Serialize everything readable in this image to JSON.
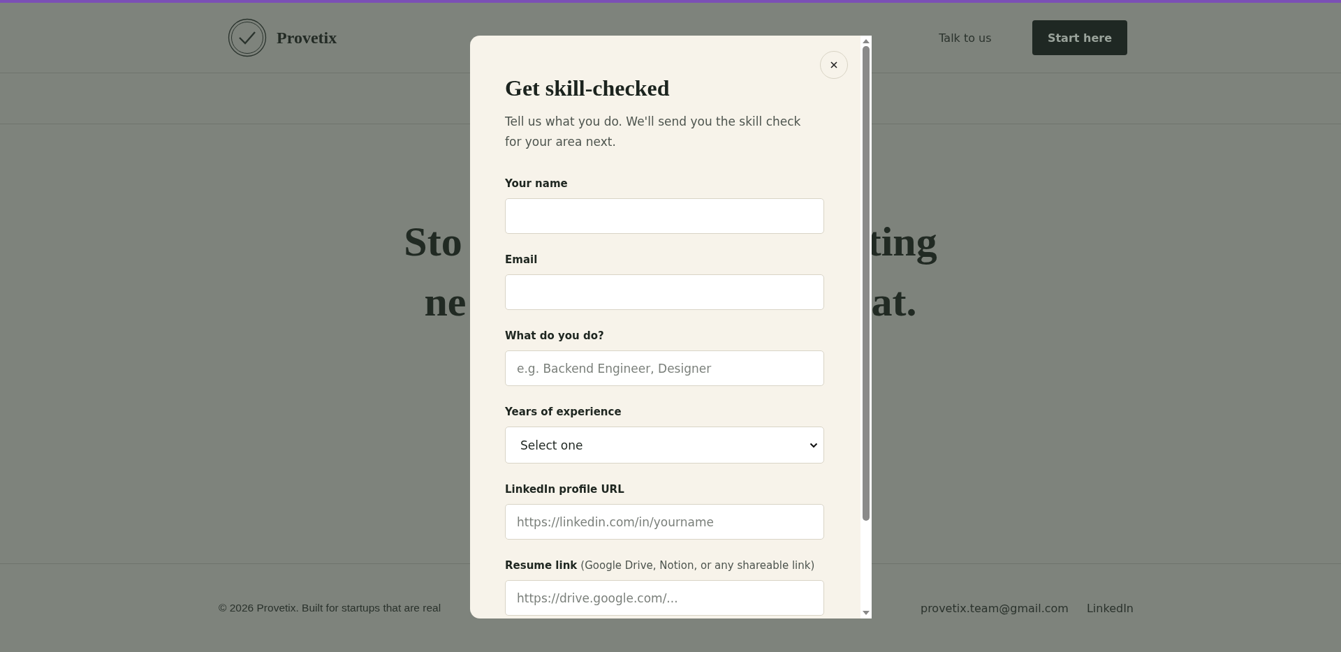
{
  "header": {
    "brand": "Provetix",
    "nav": [
      {
        "label": "Talk to us"
      }
    ],
    "cta": "Start here"
  },
  "hero": {
    "fragments": [
      "Sto",
      "ting",
      "ne",
      "at."
    ]
  },
  "modal": {
    "title": "Get skill-checked",
    "description": "Tell us what you do. We'll send you the skill check for your area next.",
    "fields": [
      {
        "kind": "text",
        "label": "Your name"
      },
      {
        "kind": "text",
        "label": "Email"
      },
      {
        "kind": "text",
        "label": "What do you do?",
        "placeholder": "e.g. Backend Engineer, Designer"
      },
      {
        "kind": "select",
        "label": "Years of experience",
        "value": "Select one"
      },
      {
        "kind": "text",
        "label": "LinkedIn profile URL",
        "placeholder": "https://linkedin.com/in/yourname"
      },
      {
        "kind": "text",
        "label": "Resume link",
        "hint": "(Google Drive, Notion, or any shareable link)",
        "placeholder": "https://drive.google.com/..."
      }
    ]
  },
  "footer": {
    "copyright": "© 2026 Provetix. Built for startups that are real",
    "links": [
      "provetix.team@gmail.com",
      "LinkedIn"
    ]
  }
}
